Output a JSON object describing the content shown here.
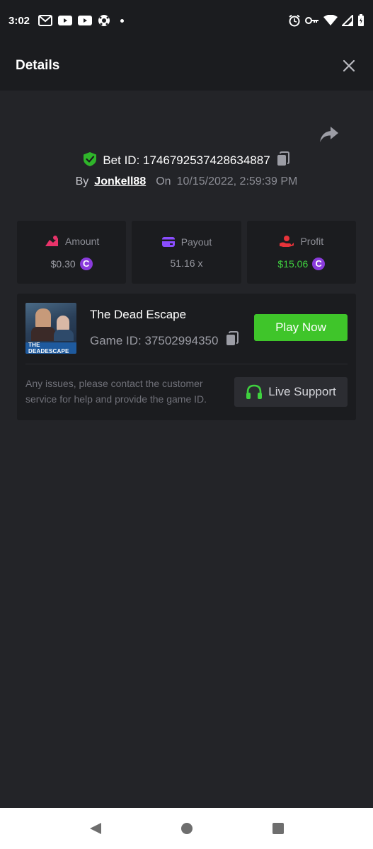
{
  "status_bar": {
    "time": "3:02",
    "left_icons": [
      "gmail-icon",
      "youtube-icon",
      "youtube-icon",
      "soccer-ball-icon",
      "dot"
    ],
    "right_icons": [
      "alarm-icon",
      "vpn-key-icon",
      "wifi-icon",
      "signal-icon",
      "battery-icon"
    ]
  },
  "header": {
    "title": "Details",
    "close_icon": "close-icon"
  },
  "bet": {
    "id_label": "Bet ID: 1746792537428634887",
    "by_label": "By",
    "username": "Jonkell88",
    "on_label": "On",
    "datetime": "10/15/2022, 2:59:39 PM"
  },
  "stats": {
    "amount": {
      "label": "Amount",
      "value": "$0.30",
      "currency_symbol": "C"
    },
    "payout": {
      "label": "Payout",
      "value": "51.16 x"
    },
    "profit": {
      "label": "Profit",
      "value": "$15.06",
      "currency_symbol": "C"
    }
  },
  "game": {
    "title": "The Dead Escape",
    "id_label": "Game ID: 37502994350",
    "thumbnail_text": "THE DEADESCAPE",
    "play_label": "Play Now",
    "issues_text": "Any issues, please contact the customer service for help and provide the game ID.",
    "support_label": "Live Support"
  },
  "colors": {
    "background": "#232428",
    "panel": "#1b1c1f",
    "accent_green": "#3fc52a",
    "profit_green": "#3fd13f",
    "coin_purple": "#8a3bdc",
    "amount_icon": "#e8336a",
    "payout_icon": "#8a4dff",
    "profit_icon": "#e8333a"
  }
}
